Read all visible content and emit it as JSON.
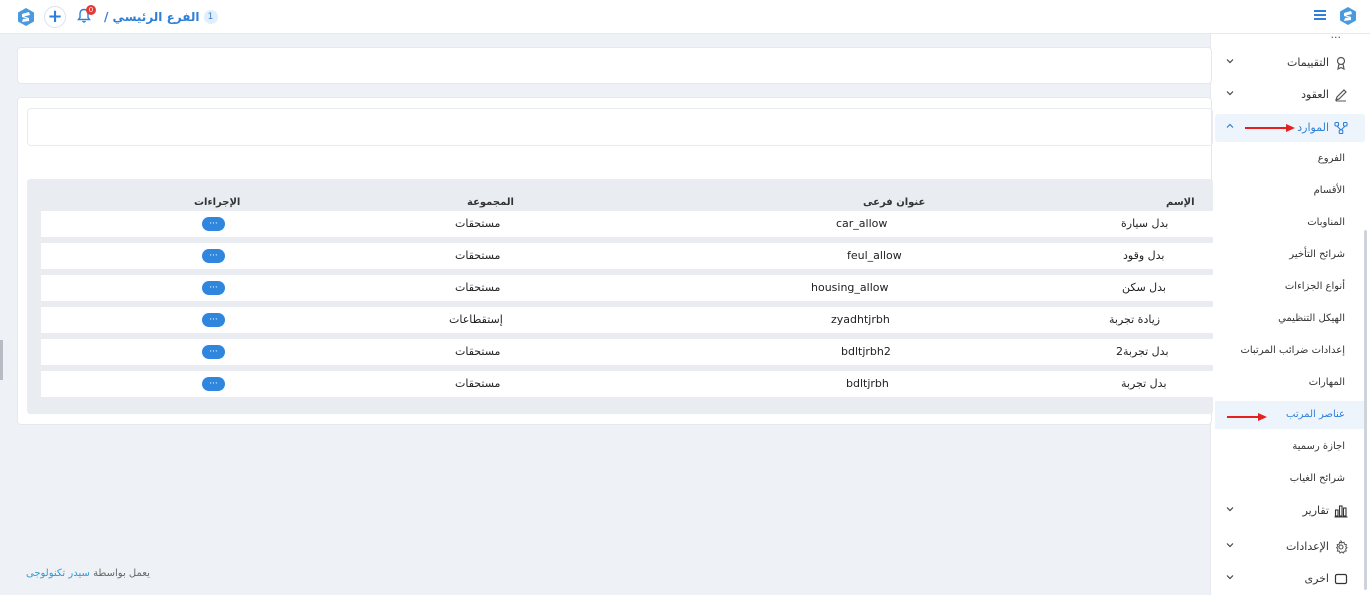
{
  "header": {
    "branch_label": "الفرع الرئيسي /",
    "branch_number": "1",
    "notification_count": "0"
  },
  "sidebar": {
    "top_cut_label": "...",
    "items": [
      {
        "label": "التقييمات"
      },
      {
        "label": "العقود"
      },
      {
        "label": "الموارد"
      },
      {
        "label": "تقارير"
      },
      {
        "label": "الإعدادات"
      },
      {
        "label": "اخرى"
      }
    ],
    "sub_items": [
      {
        "label": "الفروع"
      },
      {
        "label": "الأقسام"
      },
      {
        "label": "المناوبات"
      },
      {
        "label": "شرائح التأخير"
      },
      {
        "label": "أنواع الجزاءات"
      },
      {
        "label": "الهيكل التنظيمي"
      },
      {
        "label": "إعدادات ضرائب المرتبات"
      },
      {
        "label": "المهارات"
      },
      {
        "label": "عناصر المرتب"
      },
      {
        "label": "اجازة رسمية"
      },
      {
        "label": "شرائح الغياب"
      }
    ]
  },
  "table": {
    "columns": {
      "name": "الإسم",
      "subtitle": "عنوان فرعى",
      "group": "المجموعة",
      "actions": "الإجراءات"
    },
    "rows": [
      {
        "name": "بدل سيارة",
        "subtitle": "car_allow",
        "group": "مستحقات",
        "action": "···"
      },
      {
        "name": "بدل وقود",
        "subtitle": "feul_allow",
        "group": "مستحقات",
        "action": "···"
      },
      {
        "name": "بدل سكن",
        "subtitle": "housing_allow",
        "group": "مستحقات",
        "action": "···"
      },
      {
        "name": "زيادة تجربة",
        "subtitle": "zyadhtjrbh",
        "group": "إستقطاعات",
        "action": "···"
      },
      {
        "name": "بدل تجربة2",
        "subtitle": "bdltjrbh2",
        "group": "مستحقات",
        "action": "···"
      },
      {
        "name": "بدل تجربة",
        "subtitle": "bdltjrbh",
        "group": "مستحقات",
        "action": "···"
      }
    ]
  },
  "footer": {
    "prefix": "يعمل بواسطة",
    "brand": "سيدر تكنولوجى"
  },
  "colors": {
    "accent": "#2f7fd8",
    "annotation_arrow": "#e52020"
  }
}
